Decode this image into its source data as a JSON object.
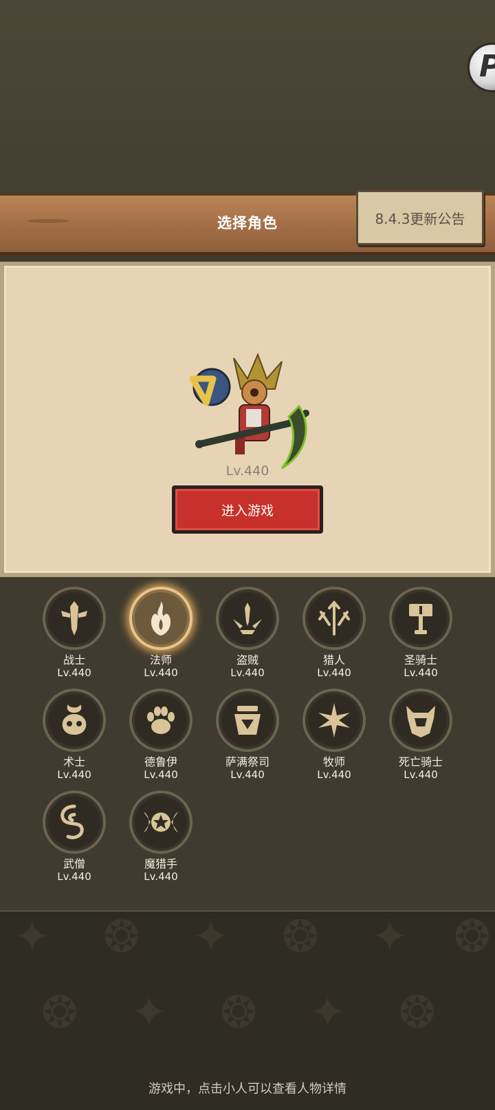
{
  "header": {
    "title": "选择角色",
    "notice_label": "8.4.3更新公告"
  },
  "hero": {
    "level": "Lv.440",
    "enter_label": "进入游戏"
  },
  "classes": [
    {
      "name": "战士",
      "level": "Lv.440",
      "icon": "warrior-sword-icon"
    },
    {
      "name": "法师",
      "level": "Lv.440",
      "icon": "mage-flame-icon",
      "selected": true
    },
    {
      "name": "盗贼",
      "level": "Lv.440",
      "icon": "rogue-daggers-icon"
    },
    {
      "name": "猎人",
      "level": "Lv.440",
      "icon": "hunter-arrows-icon"
    },
    {
      "name": "圣骑士",
      "level": "Lv.440",
      "icon": "paladin-hammer-icon"
    },
    {
      "name": "术士",
      "level": "Lv.440",
      "icon": "warlock-skull-icon"
    },
    {
      "name": "德鲁伊",
      "level": "Lv.440",
      "icon": "druid-paw-icon"
    },
    {
      "name": "萨满祭司",
      "level": "Lv.440",
      "icon": "shaman-totem-icon"
    },
    {
      "name": "牧师",
      "level": "Lv.440",
      "icon": "priest-star-icon"
    },
    {
      "name": "死亡骑士",
      "level": "Lv.440",
      "icon": "deathknight-helm-icon"
    },
    {
      "name": "武僧",
      "level": "Lv.440",
      "icon": "monk-swirl-icon"
    },
    {
      "name": "魔猎手",
      "level": "Lv.440",
      "icon": "demonhunter-star-icon"
    }
  ],
  "footer": {
    "hint": "游戏中，点击小人可以查看人物详情"
  },
  "colors": {
    "background": "#3f3b2e",
    "plank": "#a7724a",
    "parchment": "#e6d4b4",
    "enter_button": "#c8302b",
    "icon_gold": "#d9c49a"
  }
}
